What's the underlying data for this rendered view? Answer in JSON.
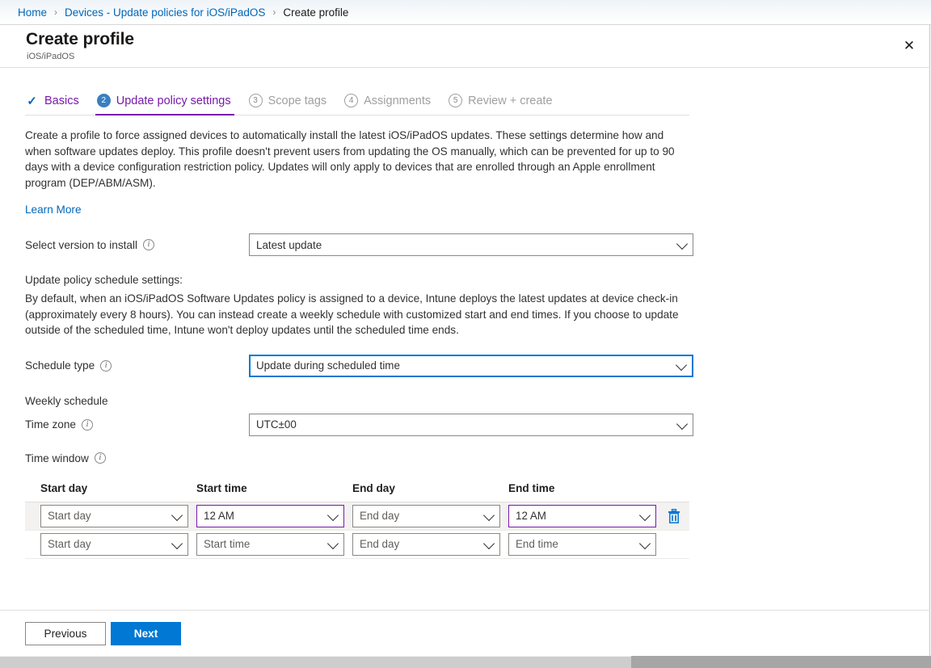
{
  "breadcrumb": {
    "items": [
      {
        "label": "Home",
        "current": false
      },
      {
        "label": "Devices - Update policies for iOS/iPadOS",
        "current": false
      },
      {
        "label": "Create profile",
        "current": true
      }
    ],
    "separator": "›"
  },
  "blade": {
    "title": "Create profile",
    "subtitle": "iOS/iPadOS",
    "close_icon": "✕"
  },
  "wizard": {
    "tabs": [
      {
        "badge": "✓",
        "label": "Basics",
        "state": "done"
      },
      {
        "badge": "2",
        "label": "Update policy settings",
        "state": "active"
      },
      {
        "badge": "3",
        "label": "Scope tags",
        "state": "inactive"
      },
      {
        "badge": "4",
        "label": "Assignments",
        "state": "inactive"
      },
      {
        "badge": "5",
        "label": "Review + create",
        "state": "inactive"
      }
    ]
  },
  "main": {
    "intro_paragraph": "Create a profile to force assigned devices to automatically install the latest iOS/iPadOS updates. These settings determine how and when software updates deploy. This profile doesn't prevent users from updating the OS manually, which can be prevented for up to 90 days with a device configuration restriction policy. Updates will only apply to devices that are enrolled through an Apple enrollment program (DEP/ABM/ASM).",
    "learn_more": "Learn More",
    "version_label": "Select version to install",
    "version_value": "Latest update",
    "schedule_settings_heading": "Update policy schedule settings:",
    "schedule_paragraph": "By default, when an iOS/iPadOS Software Updates policy is assigned to a device, Intune deploys the latest updates at device check-in (approximately every 8 hours). You can instead create a weekly schedule with customized start and end times. If you choose to update outside of the scheduled time, Intune won't deploy updates until the scheduled time ends.",
    "schedule_type_label": "Schedule type",
    "schedule_type_value": "Update during scheduled time",
    "weekly_schedule_heading": "Weekly schedule",
    "time_zone_label": "Time zone",
    "time_zone_value": "UTC±00",
    "time_window_label": "Time window"
  },
  "time_window_table": {
    "columns": [
      "Start day",
      "Start time",
      "End day",
      "End time"
    ],
    "rows": [
      {
        "shaded": true,
        "start_day": "Start day",
        "start_day_placeholder": true,
        "start_time": "12 AM",
        "start_time_placeholder": false,
        "end_day": "End day",
        "end_day_placeholder": true,
        "end_time": "12 AM",
        "end_time_placeholder": false,
        "has_delete": true,
        "delete_icon": "trash-icon"
      },
      {
        "shaded": false,
        "start_day": "Start day",
        "start_day_placeholder": true,
        "start_time": "Start time",
        "start_time_placeholder": true,
        "end_day": "End day",
        "end_day_placeholder": true,
        "end_time": "End time",
        "end_time_placeholder": true,
        "has_delete": false,
        "delete_icon": ""
      }
    ]
  },
  "footer": {
    "previous_label": "Previous",
    "next_label": "Next"
  },
  "colors": {
    "accent_purple": "#7719aa",
    "link_blue": "#0067b8",
    "primary_button": "#0078d4",
    "focus_border": "#0078d4",
    "delete_icon": "#0078d4",
    "row_shade": "#f3f2f1"
  }
}
